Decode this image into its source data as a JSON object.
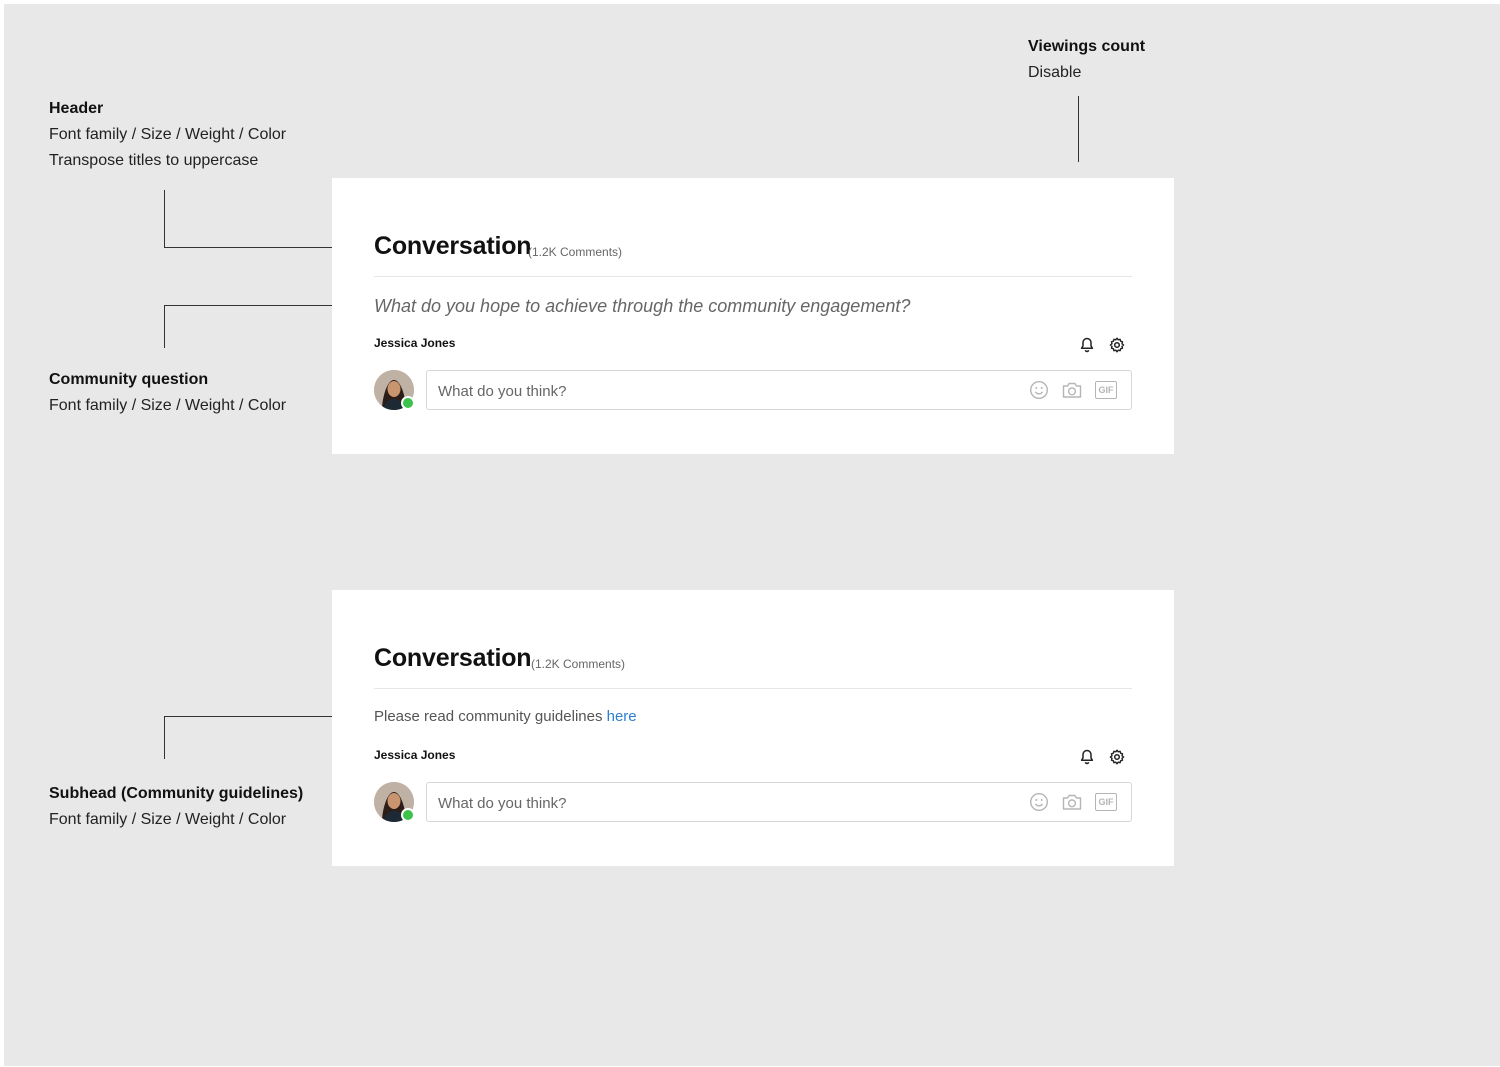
{
  "annotations": {
    "viewings": {
      "title": "Viewings count",
      "lines": [
        "Disable"
      ]
    },
    "header": {
      "title": "Header",
      "lines": [
        "Font family / Size / Weight / Color",
        "Transpose titles to uppercase"
      ]
    },
    "community_question": {
      "title": "Community question",
      "lines": [
        "Font family / Size / Weight / Color"
      ]
    },
    "subhead": {
      "title": "Subhead (Community guidelines)",
      "lines": [
        "Font family / Size / Weight / Color"
      ]
    }
  },
  "cards": [
    {
      "title": "Conversation",
      "count": "(1.2K Comments)",
      "question": "What do you hope to achieve through the community engagement?",
      "user": "Jessica Jones",
      "input_placeholder": "What do you think?"
    },
    {
      "title": "Conversation",
      "count": "(1.2K Comments)",
      "guidelines_text": "Please read community guidelines ",
      "guidelines_link": "here",
      "user": "Jessica Jones",
      "input_placeholder": "What do you think?"
    }
  ],
  "icons": {
    "notifications": "bell-icon",
    "settings": "gear-icon",
    "emoji": "smiley-icon",
    "photo": "camera-icon",
    "gif": "gif-icon",
    "gif_label": "GIF"
  },
  "colors": {
    "background": "#e8e8e8",
    "card": "#ffffff",
    "link": "#2f7fd0",
    "online": "#3cc24a"
  }
}
